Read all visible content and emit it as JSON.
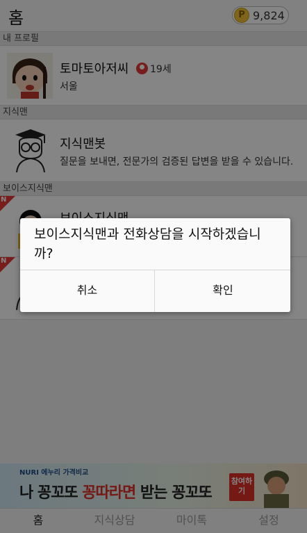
{
  "header": {
    "title": "홈",
    "points_icon": "P",
    "points_value": "9,824"
  },
  "sections": {
    "my_profile": "내 프로필",
    "jisikman": "지식맨",
    "voice_jisikman": "보이스지식맨"
  },
  "profile": {
    "name": "토마토아저씨",
    "age": "19세",
    "location": "서울"
  },
  "bot": {
    "name": "지식맨봇",
    "description": "질문을 보내면, 전문가의 검증된 답변을 받을 수 있습니다."
  },
  "voice": {
    "item1_name": "보이스지식맨",
    "new_badge": "N"
  },
  "dialog": {
    "message": "보이스지식맨과 전화상담을 시작하겠습니까?",
    "cancel_label": "취소",
    "confirm_label": "확인"
  },
  "ad": {
    "brand": "NURI 에누리 가격비교",
    "text_a": "나 ",
    "text_b": "꽁꼬또 ",
    "text_c": "꽁따라면",
    "text_d": " 받는 ",
    "text_e": "꽁꼬또",
    "cta": "참여하기"
  },
  "tabs": [
    {
      "label": "홈"
    },
    {
      "label": "지식상담"
    },
    {
      "label": "마이톡"
    },
    {
      "label": "설정"
    }
  ]
}
